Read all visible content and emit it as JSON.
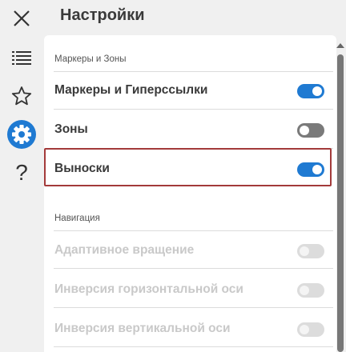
{
  "header": {
    "title": "Настройки"
  },
  "rail": {
    "icons": [
      "close-icon",
      "list-icon",
      "star-icon",
      "gear-icon",
      "help-icon"
    ],
    "help_glyph": "?"
  },
  "sections": [
    {
      "title": "Маркеры и Зоны",
      "items": [
        {
          "label": "Маркеры и Гиперссылки",
          "state": "on"
        },
        {
          "label": "Зоны",
          "state": "off"
        },
        {
          "label": "Выноски",
          "state": "on"
        }
      ]
    },
    {
      "title": "Навигация",
      "items": [
        {
          "label": "Адаптивное вращение",
          "state": "disabled"
        },
        {
          "label": "Инверсия горизонтальной оси",
          "state": "disabled"
        },
        {
          "label": "Инверсия вертикальной оси",
          "state": "disabled"
        }
      ]
    }
  ],
  "colors": {
    "accent": "#1f7ad2",
    "highlight": "#a33a3a",
    "active_rail": "#1f7ad2"
  }
}
